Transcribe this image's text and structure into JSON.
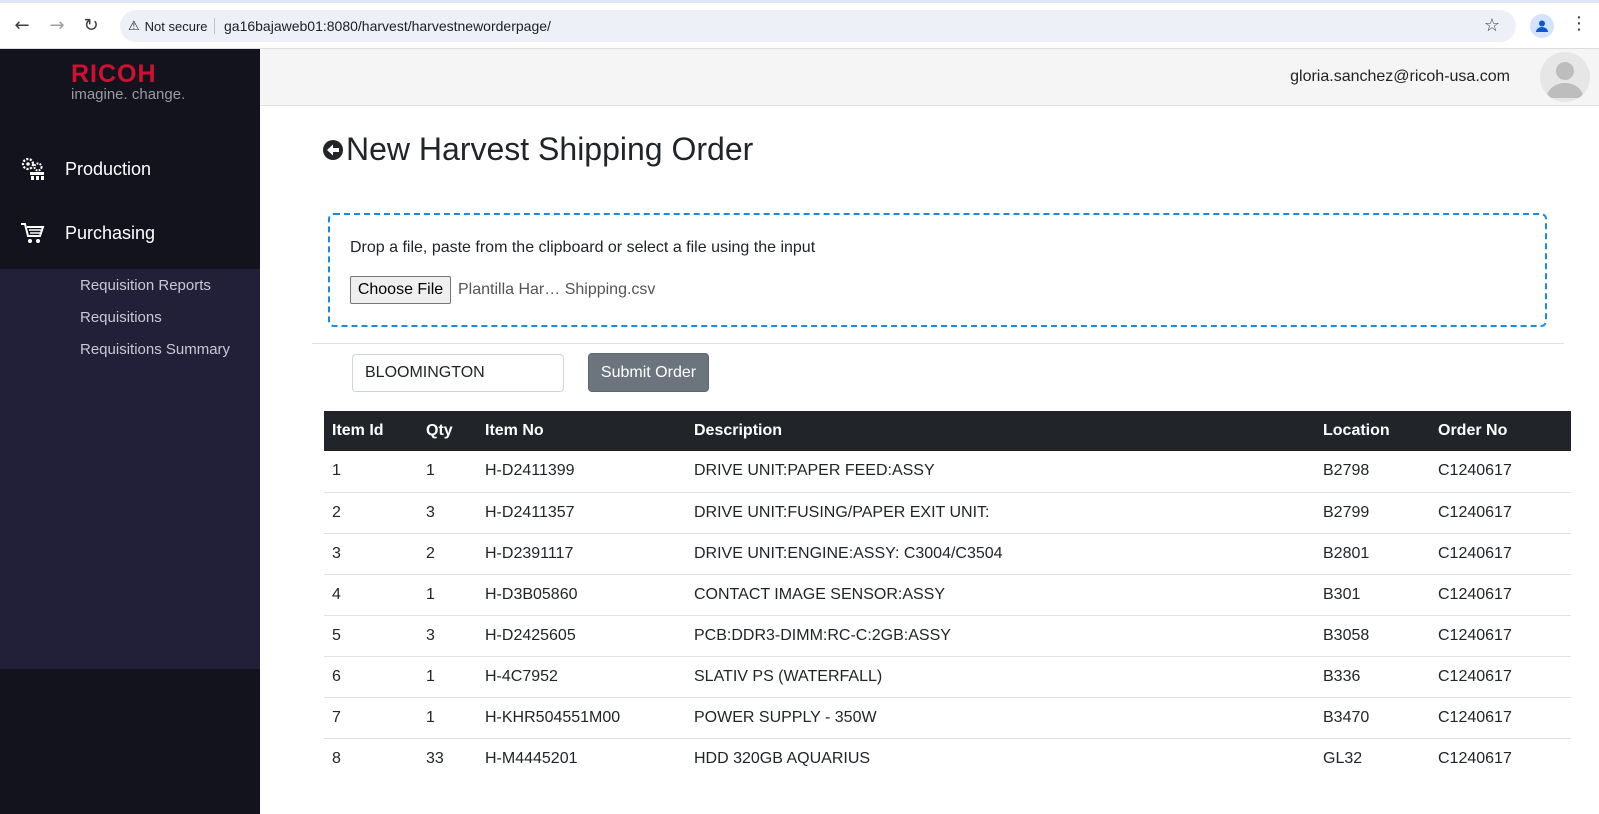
{
  "browser": {
    "security_label": "Not secure",
    "url": "ga16bajaweb01:8080/harvest/harvestneworderpage/"
  },
  "sidebar": {
    "logo": {
      "main": "RICOH",
      "tagline": "imagine. change."
    },
    "items": [
      {
        "label": "Production",
        "icon": "production-gears-icon"
      },
      {
        "label": "Purchasing",
        "icon": "cart-icon"
      }
    ],
    "submenu": [
      {
        "label": "Requisition Reports"
      },
      {
        "label": "Requisitions"
      },
      {
        "label": "Requisitions Summary"
      }
    ]
  },
  "header": {
    "user_email": "gloria.sanchez@ricoh-usa.com"
  },
  "main": {
    "title": "New Harvest Shipping Order",
    "dropzone": {
      "instructions": "Drop a file, paste from the clipboard or select a file using the input",
      "file_button": "Choose File",
      "file_name": "Plantilla Har… Shipping.csv"
    },
    "location_value": "BLOOMINGTON",
    "submit_label": "Submit Order",
    "table": {
      "headers": [
        "Item Id",
        "Qty",
        "Item No",
        "Description",
        "Location",
        "Order No"
      ],
      "rows": [
        [
          "1",
          "1",
          "H-D2411399",
          "DRIVE UNIT:PAPER FEED:ASSY",
          "B2798",
          "C1240617"
        ],
        [
          "2",
          "3",
          "H-D2411357",
          "DRIVE UNIT:FUSING/PAPER EXIT UNIT:",
          "B2799",
          "C1240617"
        ],
        [
          "3",
          "2",
          "H-D2391117",
          "DRIVE UNIT:ENGINE:ASSY: C3004/C3504",
          "B2801",
          "C1240617"
        ],
        [
          "4",
          "1",
          "H-D3B05860",
          "CONTACT IMAGE SENSOR:ASSY",
          "B301",
          "C1240617"
        ],
        [
          "5",
          "3",
          "H-D2425605",
          "PCB:DDR3-DIMM:RC-C:2GB:ASSY",
          "B3058",
          "C1240617"
        ],
        [
          "6",
          "1",
          "H-4C7952",
          "SLATIV PS (WATERFALL)",
          "B336",
          "C1240617"
        ],
        [
          "7",
          "1",
          "H-KHR504551M00",
          "POWER SUPPLY - 350W",
          "B3470",
          "C1240617"
        ],
        [
          "8",
          "33",
          "H-M4445201",
          "HDD 320GB AQUARIUS",
          "GL32",
          "C1240617"
        ]
      ]
    }
  },
  "colors": {
    "sidebar_bg": "#13131e",
    "submenu_bg": "#222038",
    "brand_red": "#cf1131",
    "table_header_bg": "#212529",
    "dropzone_border": "#1e88e5",
    "submit_bg": "#6c757d"
  }
}
